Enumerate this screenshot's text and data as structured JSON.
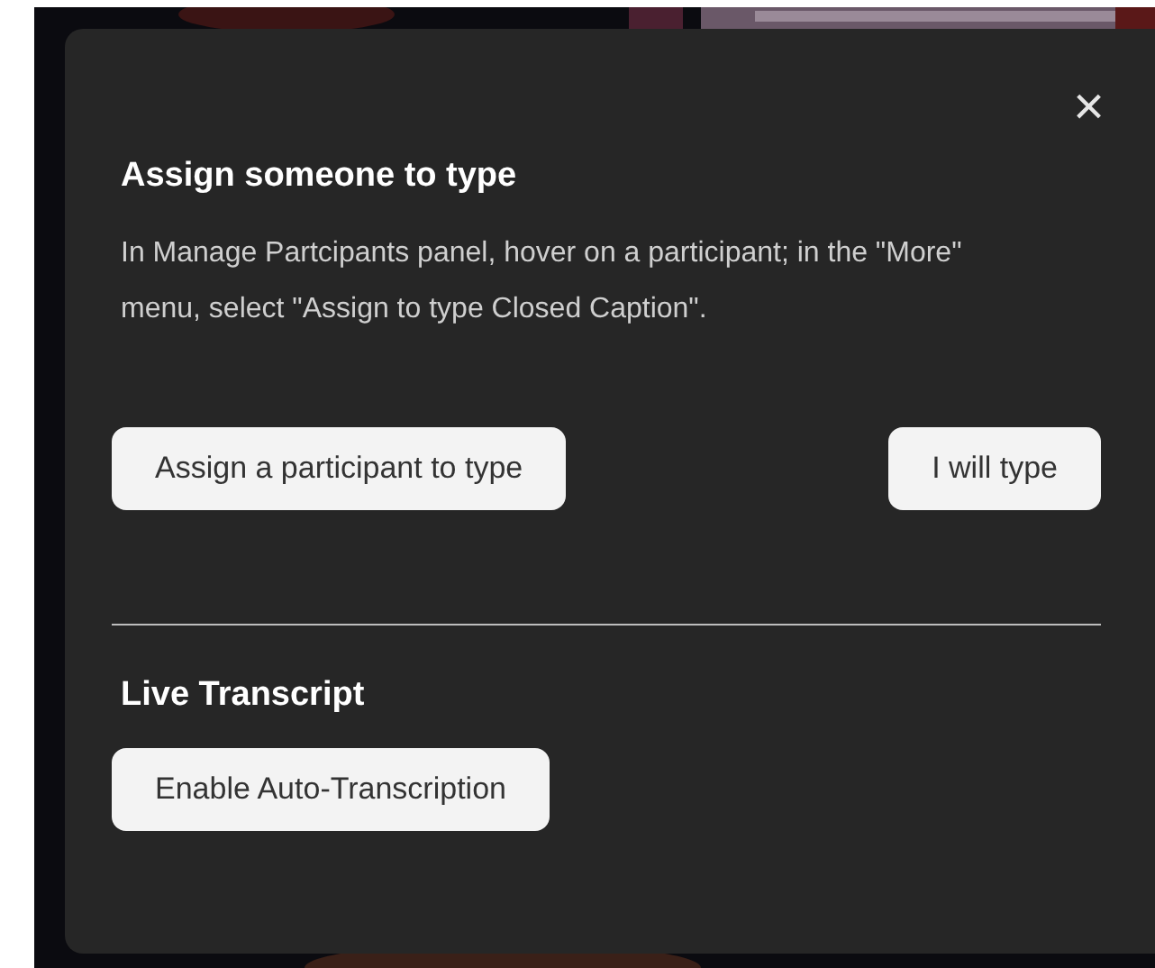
{
  "popup": {
    "close": "×",
    "title": "Assign someone to type",
    "description": "In Manage Partcipants panel, hover on a participant; in the \"More\" menu, select \"Assign to type Closed Caption\".",
    "buttons": [
      "Assign a participant to type",
      "I will type"
    ],
    "section_title": "Live Transcript",
    "section_buttons": [
      "Enable Auto-Transcription"
    ]
  }
}
